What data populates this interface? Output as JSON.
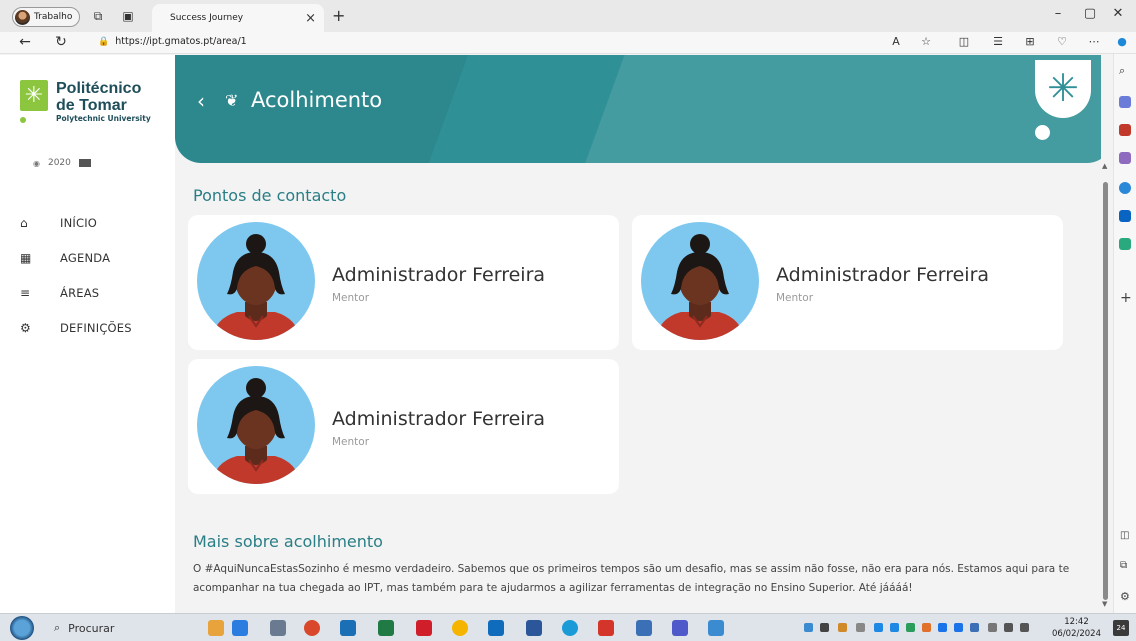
{
  "browser": {
    "profile_label": "Trabalho",
    "tab_title": "Success Journey",
    "url": "https://ipt.gmatos.pt/area/1"
  },
  "sidebar": {
    "logo_line1": "Politécnico",
    "logo_line2": "de Tomar",
    "logo_line3": "Polytechnic University",
    "sponsor_text": "2020",
    "items": [
      {
        "label": "INÍCIO",
        "icon": "home-icon"
      },
      {
        "label": "AGENDA",
        "icon": "calendar-icon"
      },
      {
        "label": "ÁREAS",
        "icon": "menu-icon"
      },
      {
        "label": "DEFINIÇÕES",
        "icon": "gear-icon"
      }
    ]
  },
  "header": {
    "title": "Acolhimento",
    "back_icon": "chevron-left-icon",
    "title_icon": "hands-icon"
  },
  "contacts": {
    "section_title": "Pontos de contacto",
    "cards": [
      {
        "name": "Administrador Ferreira",
        "role": "Mentor"
      },
      {
        "name": "Administrador Ferreira",
        "role": "Mentor"
      },
      {
        "name": "Administrador Ferreira",
        "role": "Mentor"
      }
    ]
  },
  "about": {
    "section_title": "Mais sobre acolhimento",
    "text": "O #AquiNuncaEstasSozinho é mesmo verdadeiro. Sabemos que os primeiros tempos são um desafio, mas se assim não fosse, não era para nós. Estamos aqui para te acompanhar na tua chegada ao IPT, mas também para te ajudarmos a agilizar ferramentas de integração no Ensino Superior. Até jáááá!"
  },
  "taskbar": {
    "search_label": "Procurar",
    "time": "12:42",
    "date": "06/02/2024",
    "notification_count": "24"
  },
  "colors": {
    "accent": "#2f9196",
    "brand_green": "#8cc63f",
    "section_title": "#2a7e85"
  }
}
